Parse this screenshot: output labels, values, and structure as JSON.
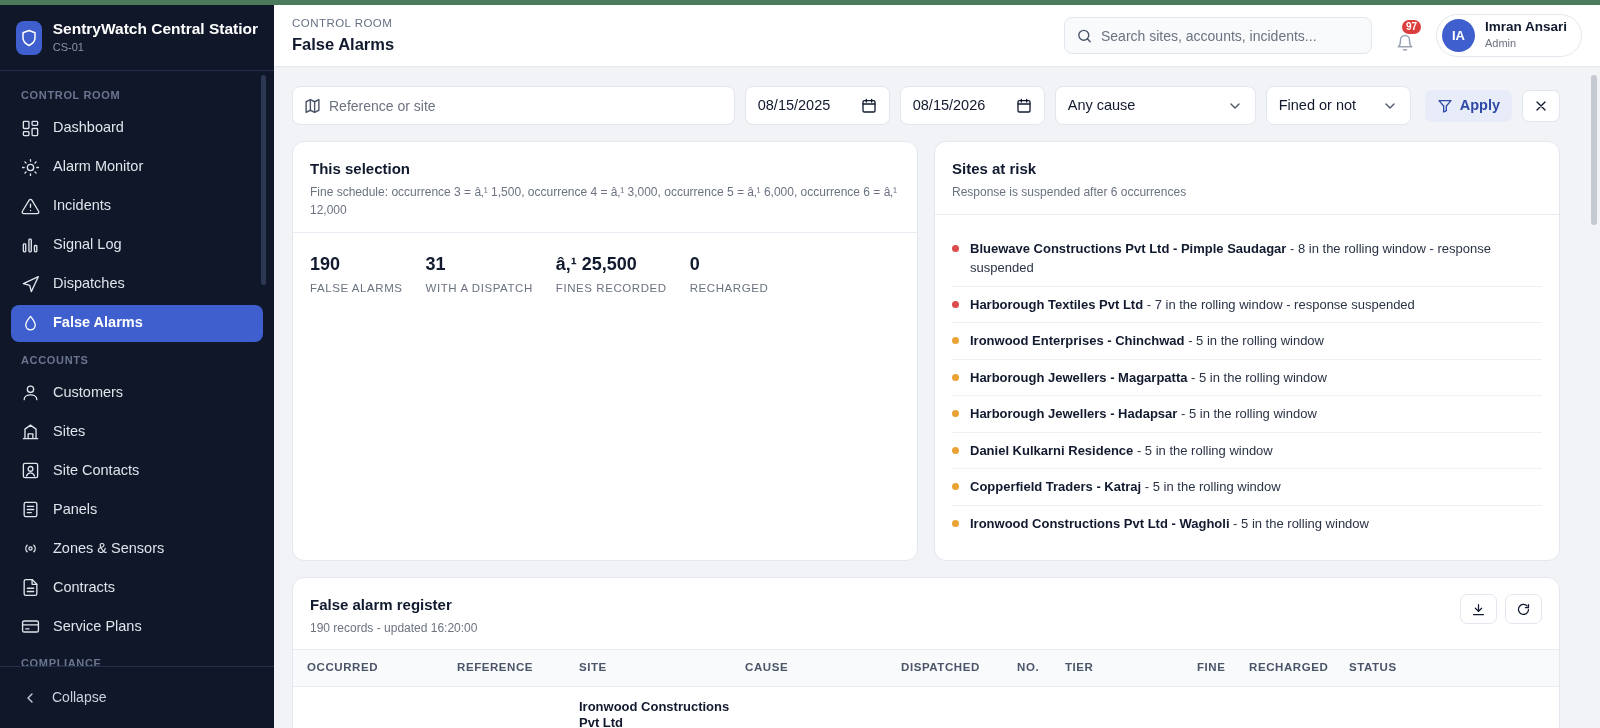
{
  "brand": {
    "title": "SentryWatch Central Statior",
    "code": "CS-01"
  },
  "sidebar": {
    "sections": [
      {
        "label": "CONTROL ROOM",
        "items": [
          {
            "label": "Dashboard",
            "selected": false
          },
          {
            "label": "Alarm Monitor",
            "selected": false
          },
          {
            "label": "Incidents",
            "selected": false
          },
          {
            "label": "Signal Log",
            "selected": false
          },
          {
            "label": "Dispatches",
            "selected": false
          },
          {
            "label": "False Alarms",
            "selected": true
          }
        ]
      },
      {
        "label": "ACCOUNTS",
        "items": [
          {
            "label": "Customers",
            "selected": false
          },
          {
            "label": "Sites",
            "selected": false
          },
          {
            "label": "Site Contacts",
            "selected": false
          },
          {
            "label": "Panels",
            "selected": false
          },
          {
            "label": "Zones & Sensors",
            "selected": false
          },
          {
            "label": "Contracts",
            "selected": false
          },
          {
            "label": "Service Plans",
            "selected": false
          }
        ]
      },
      {
        "label": "COMPLIANCE"
      }
    ],
    "collapse": "Collapse"
  },
  "header": {
    "eyebrow": "CONTROL ROOM",
    "title": "False Alarms",
    "search_placeholder": "Search sites, accounts, incidents...",
    "notifications": "97",
    "user": {
      "initials": "IA",
      "name": "Imran Ansari",
      "role": "Admin"
    }
  },
  "filters": {
    "reference_placeholder": "Reference or site",
    "date_from": "08/15/2025",
    "date_to": "08/15/2026",
    "cause": "Any cause",
    "fined": "Fined or not",
    "apply": "Apply"
  },
  "selection": {
    "title": "This selection",
    "subtitle": "Fine schedule: occurrence 3 = â‚¹ 1,500, occurrence 4 = â‚¹ 3,000, occurrence 5 = â‚¹ 6,000, occurrence 6 = â‚¹ 12,000",
    "stats": [
      {
        "value": "190",
        "label": "FALSE ALARMS"
      },
      {
        "value": "31",
        "label": "WITH A DISPATCH"
      },
      {
        "value": "â‚¹ 25,500",
        "label": "FINES RECORDED"
      },
      {
        "value": "0",
        "label": "RECHARGED"
      }
    ]
  },
  "risk": {
    "title": "Sites at risk",
    "subtitle": "Response is suspended after 6 occurrences",
    "items": [
      {
        "text": "**Bluewave Constructions Pvt Ltd - Pimple Saudagar** - 8 in the rolling window - response suspended",
        "color": "#dc4c4c"
      },
      {
        "text": "**Harborough Textiles Pvt Ltd** - 7 in the rolling window - response suspended",
        "color": "#dc4c4c"
      },
      {
        "text": "**Ironwood Enterprises - Chinchwad** - 5 in the rolling window",
        "color": "#eba234"
      },
      {
        "text": "**Harborough Jewellers - Magarpatta** - 5 in the rolling window",
        "color": "#eba234"
      },
      {
        "text": "**Harborough Jewellers - Hadapsar** - 5 in the rolling window",
        "color": "#eba234"
      },
      {
        "text": "**Daniel Kulkarni Residence** - 5 in the rolling window",
        "color": "#eba234"
      },
      {
        "text": "**Copperfield Traders - Katraj** - 5 in the rolling window",
        "color": "#eba234"
      },
      {
        "text": "**Ironwood Constructions Pvt Ltd - Wagholi** - 5 in the rolling window",
        "color": "#eba234"
      }
    ]
  },
  "register": {
    "title": "False alarm register",
    "subtitle": "190 records - updated 16:20:00",
    "columns": [
      "OCCURRED",
      "REFERENCE",
      "SITE",
      "CAUSE",
      "DISPATCHED",
      "NO.",
      "TIER",
      "FINE",
      "RECHARGED",
      "STATUS"
    ],
    "rows": [
      {
        "site": "Ironwood Constructions Pvt Ltd"
      }
    ]
  }
}
